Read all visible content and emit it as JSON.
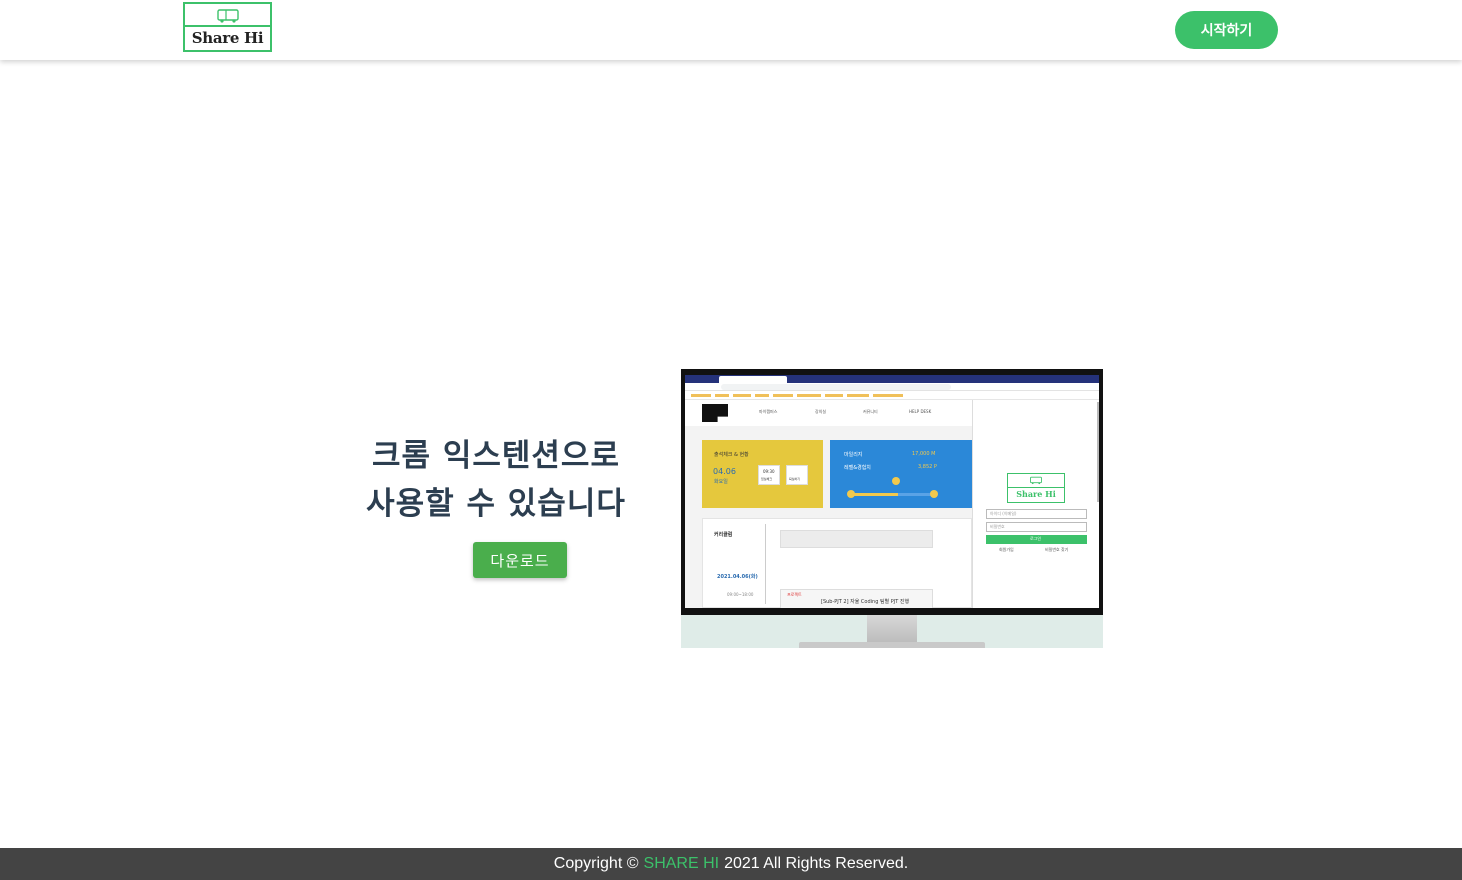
{
  "header": {
    "logo_text": "Share Hi",
    "start_button_label": "시작하기"
  },
  "hero": {
    "title_line1": "크롬 익스텐션으로",
    "title_line2": "사용할 수 있습니다",
    "download_button_label": "다운로드"
  },
  "mockup": {
    "nav_items": [
      "마이캠퍼스",
      "강의실",
      "커뮤니티",
      "HELP DESK"
    ],
    "yellow_card": {
      "title": "출석체크 & 현황",
      "date": "04.06",
      "weekday": "화요일",
      "time": "09:30",
      "checkin_label": "입실체크",
      "checkout_label": "퇴실하기"
    },
    "blue_card": {
      "mileage_label": "마일리지",
      "mileage_value": "17,000 M",
      "level_label": "레벨&경험치",
      "level_value": "3,852 P"
    },
    "curriculum": {
      "title": "커리큘럼",
      "date": "2021.04.06(화)",
      "time": "09:00~18:00",
      "item_tag": "프로젝트",
      "item_text": "[Sub-PJT 2] 자율 Coding 팀별 PJT 진행"
    },
    "popup": {
      "logo_text": "Share Hi",
      "id_placeholder": "아이디 (이메일)",
      "pw_placeholder": "비밀번호",
      "login_label": "로그인",
      "signup_label": "회원가입",
      "find_pw_label": "비밀번호 찾기"
    }
  },
  "footer": {
    "prefix": "Copyright ©",
    "brand": "SHARE HI",
    "suffix": "2021 All Rights Reserved."
  },
  "colors": {
    "accent_green": "#3cc16a",
    "download_green": "#4aae4c",
    "title_color": "#2c3e50",
    "footer_bg": "#444444"
  }
}
